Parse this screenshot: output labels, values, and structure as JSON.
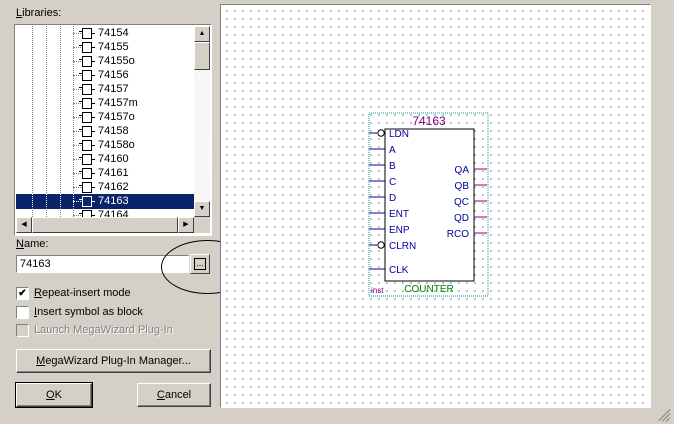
{
  "left_panel": {
    "libraries_label_pre": "",
    "libraries_label_mnemonic": "L",
    "libraries_label_post": "ibraries:",
    "library_items": [
      {
        "label": "74154",
        "selected": false
      },
      {
        "label": "74155",
        "selected": false
      },
      {
        "label": "74155o",
        "selected": false
      },
      {
        "label": "74156",
        "selected": false
      },
      {
        "label": "74157",
        "selected": false
      },
      {
        "label": "74157m",
        "selected": false
      },
      {
        "label": "74157o",
        "selected": false
      },
      {
        "label": "74158",
        "selected": false
      },
      {
        "label": "74158o",
        "selected": false
      },
      {
        "label": "74160",
        "selected": false
      },
      {
        "label": "74161",
        "selected": false
      },
      {
        "label": "74162",
        "selected": false
      },
      {
        "label": "74163",
        "selected": true
      },
      {
        "label": "74164",
        "selected": false
      }
    ],
    "name_label_pre": "",
    "name_label_mnemonic": "N",
    "name_label_post": "ame:",
    "name_value": "74163",
    "browse_label": "...",
    "repeat_insert": {
      "pre": "",
      "mnemonic": "R",
      "post": "epeat-insert mode",
      "checked": true,
      "mark": "✔"
    },
    "insert_block": {
      "pre": "",
      "mnemonic": "I",
      "post": "nsert symbol as block",
      "checked": false
    },
    "launch_megawizard": {
      "pre": "Launch MegaWizard Plug-In",
      "checked": false,
      "disabled": true
    },
    "megawizard_button": {
      "pre": "",
      "mnemonic": "M",
      "post": "egaWizard Plug-In Manager..."
    },
    "ok_button": {
      "pre": "",
      "mnemonic": "O",
      "post": "K"
    },
    "cancel_button": {
      "pre": "",
      "mnemonic": "C",
      "post": "ancel"
    }
  },
  "symbol": {
    "name": "74163",
    "inputs": [
      "LDN",
      "A",
      "B",
      "C",
      "D",
      "ENT",
      "ENP",
      "CLRN",
      "CLK"
    ],
    "inverted_inputs": [
      "LDN",
      "CLRN"
    ],
    "outputs": [
      "QA",
      "QB",
      "QC",
      "QD",
      "RCO"
    ],
    "instance_label": "inst",
    "type_label": "COUNTER"
  },
  "colors": {
    "dialog_bg": "#d4d0c8",
    "selection": "#0a246a",
    "pin_blue": "#0000a0",
    "output_purple": "#800080",
    "counter_green": "#008000",
    "symbol_border": "#00a0a0"
  }
}
